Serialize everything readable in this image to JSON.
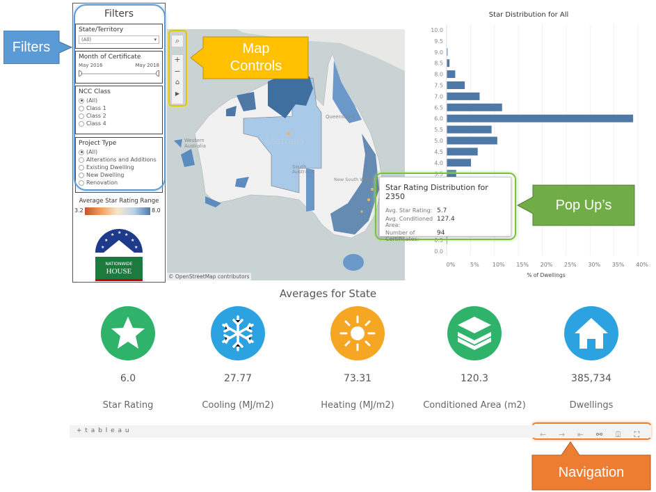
{
  "filters": {
    "title": "Filters",
    "state": {
      "label": "State/Territory",
      "value": "(All)"
    },
    "month": {
      "label": "Month of Certificate",
      "start": "May 2016",
      "end": "May 2018"
    },
    "ncc": {
      "label": "NCC Class",
      "options": [
        "(All)",
        "Class 1",
        "Class 2",
        "Class 4"
      ],
      "selected": "(All)"
    },
    "project": {
      "label": "Project Type",
      "options": [
        "(All)",
        "Alterations and Additions",
        "Existing Dwelling",
        "New Dwelling",
        "Renovation"
      ],
      "selected": "(All)"
    },
    "legend": {
      "title": "Average Star Rating Range",
      "min": "3.2",
      "max": "8.0"
    },
    "logo": {
      "text": "NATIONWIDE HOUSE ENERGY RATING SCHEME"
    }
  },
  "map": {
    "attribution": "© OpenStreetMap contributors",
    "labels": [
      "Western Australia",
      "Australia",
      "South Australia",
      "New South Wales",
      "Queensland"
    ],
    "controls": [
      "search-icon",
      "zoom-in-icon",
      "zoom-out-icon",
      "home-icon",
      "play-icon"
    ]
  },
  "callouts": {
    "filters": "Filters",
    "map_controls": "Map Controls",
    "popups": "Pop Up’s",
    "navigation": "Navigation"
  },
  "tooltip": {
    "title": "Star Rating Distribution for 2350",
    "rows": [
      {
        "k": "Avg. Star Rating:",
        "v": "5.7"
      },
      {
        "k": "Avg. Conditioned Area:",
        "v": "127.4"
      },
      {
        "k": "Number of Certificates:",
        "v": "94"
      }
    ]
  },
  "chart_data": {
    "type": "bar",
    "orientation": "horizontal",
    "title": "Star Distribution for All",
    "xlabel": "% of Dwellings",
    "ylabel": "",
    "categories": [
      "10.0",
      "9.5",
      "9.0",
      "8.5",
      "8.0",
      "7.5",
      "7.0",
      "6.5",
      "6.0",
      "5.5",
      "5.0",
      "4.5",
      "4.0",
      "3.5",
      "3.0",
      "2.5",
      "2.0",
      "1.5",
      "1.0",
      "0.5",
      "0.0"
    ],
    "values": [
      0,
      0,
      0.2,
      0.6,
      1.8,
      3.8,
      6.9,
      11.6,
      39.0,
      9.4,
      10.6,
      6.5,
      5.1,
      2.0,
      null,
      null,
      null,
      null,
      0.1,
      0.1,
      0
    ],
    "xticks": [
      "0%",
      "5%",
      "10%",
      "15%",
      "20%",
      "25%",
      "30%",
      "35%",
      "40%"
    ],
    "xlim": [
      0,
      41
    ],
    "color": "#4e79a7"
  },
  "averages": {
    "title": "Averages for State",
    "kpis": [
      {
        "icon": "star-icon",
        "value": "6.0",
        "label": "Star Rating",
        "color": "#2fb36a"
      },
      {
        "icon": "snowflake-icon",
        "value": "27.77",
        "label": "Cooling (MJ/m2)",
        "color": "#2ca3e0"
      },
      {
        "icon": "sun-icon",
        "value": "73.31",
        "label": "Heating (MJ/m2)",
        "color": "#f5a623"
      },
      {
        "icon": "layers-icon",
        "value": "120.3",
        "label": "Conditioned Area (m2)",
        "color": "#2fb36a"
      },
      {
        "icon": "house-icon",
        "value": "385,734",
        "label": "Dwellings",
        "color": "#2ca3e0"
      }
    ]
  },
  "footer": {
    "brand": "+ t a b l e a u",
    "nav": [
      "undo-icon",
      "redo-icon",
      "revert-icon",
      "share-icon",
      "download-icon",
      "fullscreen-icon"
    ]
  }
}
